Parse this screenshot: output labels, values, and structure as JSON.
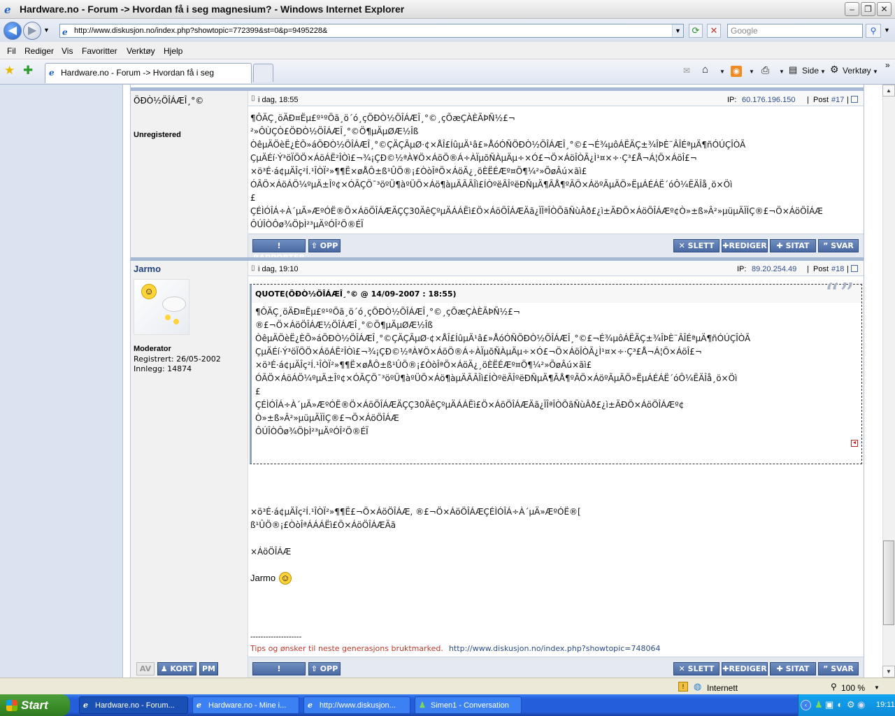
{
  "window": {
    "title": "Hardware.no - Forum -> Hvordan få i seg magnesium? - Windows Internet Explorer"
  },
  "address": {
    "url": "http://www.diskusjon.no/index.php?showtopic=772399&st=0&p=9495228&",
    "search_placeholder": "Google"
  },
  "menu": [
    "Fil",
    "Rediger",
    "Vis",
    "Favoritter",
    "Verktøy",
    "Hjelp"
  ],
  "tab": {
    "title": "Hardware.no - Forum -> Hvordan få i seg magnesium?"
  },
  "toolbar": {
    "page": "Side",
    "tools": "Verktøy"
  },
  "post17": {
    "author": "ÖÐÒ½ÖÎÁÆÎ¸°©",
    "rank": "Unregistered",
    "date": "i dag, 18:55",
    "ip_label": "IP:",
    "ip": "60.176.196.150",
    "sep": "|",
    "post_label": "Post",
    "post_no": "#17",
    "body": "¶ÔÄÇ¸öÄÐ¤Ëµ£º¹ºÖã¸ö´ó¸çÖÐÒ½ÖÎÁÆÎ¸°©¸çÕæÇÀÈÃÞÑ½£¬\n²»ÔÙÇÒ£ÖÐÒ½ÖÎÁÆÎ¸°©Ö¶µÄµØÆ½Îß\nÒêµÄÖèË¿ÈÕ»áÖÐÒ½ÖÎÁÆÎ¸°©ÇÄÇÃµØ·¢×ÅÎ£ÍûµÄ¹â£»ÅóÓÑÖÐÒ½ÖÎÁÆÎ¸°©£¬É¾µôÁËÄÇ±¾ÎÞÈ¨ÂÎÉªµÄ¶ñÓÚÇÎÒÃ\nÇµÄÉí·Ý³öÏÖÖ×ÁöÁË²ÎÒì£¬¾¡ÇÐ©½ªÀ¥Ö×ÁöÖ®Á÷ÀÏµõÑÀµÄµ÷×Ó£¬Ö×ÁöÎÒÃ¿Ì¹¤×÷·Ç³£Å¬Á¦Ö×ÁöÎ£¬\n×ö³É·á¢µÄÎç²Í.¹ÎÒÏ²»¶¶Ë×øÅÔ±ß¹ÛÖ®¡£ÒòÎªÖ×ÁöÄ¿¸öÈËÉÆº¤Ö¶¼²»ÕøÂú×ãì£\nÓÃÖ×ÁöÁÖ¼ºµÄ±Îº¢×ÓÃÇÖ¯³öºÜ¶àºÜÖ×Áö¶àµÄÃÃÎì£ÍÒºëÃÎºëÐÑµÄ¶ÃÅ¶ºÃÖ×ÁöºÃµÄÖ»ËµÁÉÁË´óÔ¼ËÄÎå¸ö×Öì\n£\nÇÉÌÓÎÁ÷À´µÄ»ÆºÓË®Ö×ÁöÖÎÁÆÄÇÇ30ÄêÇºµÄÁÁËì£Ö×ÁöÖÎÁÆÄã¿ÏÎªÎÒÕãÑùÂð£¿ì±ÄÐÖ×ÁöÖÎÁÆº¢Ò»±ß»Â²»µüµÄÏÍÇ®£¬Ö×ÁöÖÎÁÆ\nÔÚÎÒÔø¾ÖþÌ²³µÄºÓÎ²Ö®ÉÏ"
  },
  "post18": {
    "author": "Jarmo",
    "rank": "Moderator",
    "registered": "Registrert: 26/05-2002",
    "posts": "Innlegg: 14874",
    "date": "i dag, 19:10",
    "ip_label": "IP:",
    "ip": "89.20.254.49",
    "sep": "|",
    "post_label": "Post",
    "post_no": "#18",
    "quote_header": "QUOTE(ÖÐÒ½ÖÎÁÆÎ¸°© @ 14/09-2007 : 18:55)",
    "quote_body": "¶ÔÄÇ¸öÄÐ¤Ëµ£º¹ºÖã¸ö´ó¸çÖÐÒ½ÖÎÁÆÎ¸°©¸çÕæÇÀÈÃÞÑ½£¬\n®£¬Ö×ÁöÖÎÁÆ½ÖÎÁÆÎ¸°©Ö¶µÄµØÆ½Îß\nÒêµÄÖèË¿ÈÕ»áÖÐÒ½ÖÎÁÆÎ¸°©ÇÄÇÃµØ·¢×ÅÎ£ÍûµÄ¹â£»ÅóÓÑÖÐÒ½ÖÎÁÆÎ¸°©£¬É¾µôÁËÄÇ±¾ÎÞÈ¨ÂÎÉªµÄ¶ñÓÚÇÎÒÃ\nÇµÄÉí·Ý³öÏÖÖ×ÁöÁË²ÎÒì£¬¾¡ÇÐ©½ªÀ¥Ö×ÁöÖ®Á÷ÀÏµõÑÀµÄµ÷×Ó£¬Ö×ÁöÎÒÃ¿Ì¹¤×÷·Ç³£Å¬Á¦Ö×ÁöÎ£¬\n×ö³É·á¢µÄÎç²Í.¹ÎÒÏ²»¶¶Ë×øÅÔ±ß¹ÛÖ®¡£ÒòÎªÖ×ÁöÄ¿¸öÈËÉÆº¤Ö¶¼²»ÕøÂú×ãì£\nÓÃÖ×ÁöÁÖ¼ºµÄ±Îº¢×ÓÃÇÖ¯³öºÜ¶àºÜÖ×Áö¶àµÄÃÃÎì£ÍÒºëÃÎºëÐÑµÄ¶ÃÅ¶ºÃÖ×ÁöºÃµÄÖ»ËµÁÉÁË´óÔ¼ËÄÎå¸ö×Öì\n£\nÇÉÌÓÎÁ÷À´µÄ»ÆºÓË®Ö×ÁöÖÎÁÆÄÇÇ30ÄêÇºµÄÁÁËì£Ö×ÁöÖÎÁÆÄã¿ÏÎªÎÒÕãÑùÂð£¿ì±ÄÐÖ×ÁöÖÎÁÆº¢\nÒ»±ß»Â²»µüµÄÏÍÇ®£¬Ö×ÁöÖÎÁÆ\nÔÚÎÒÔø¾ÖþÌ²³µÄºÓÎ²Ö®ÉÏ",
    "reply_line1": "×ö³É·á¢µÄÎç²Í.¹ÎÒÏ²»¶¶Ë£¬Ö×ÁöÖÎÁÆ, ®£¬Ö×ÁöÖÎÁÆÇÉÌÓÎÁ÷À´µÄ»ÆºÓË®[",
    "reply_line2": "ß¹ÛÖ®¡£ÒòÎªÁÁÁËì£Ö×ÁöÖÎÁÆÄã",
    "reply_line3": "×ÁöÖÎÁÆ",
    "reply_sign": "Jarmo",
    "sig_dashes": "--------------------",
    "sig_text": "Tips og ønsker til neste generasjons bruktmarked.",
    "sig_link": "http://www.diskusjon.no/index.php?showtopic=748064"
  },
  "buttons": {
    "report": "RAPPORTER",
    "up": "OPP",
    "delete": "SLETT",
    "edit": "REDIGER",
    "quote": "SITAT",
    "reply": "SVAR",
    "av": "AV",
    "card": "KORT",
    "pm": "PM"
  },
  "status": {
    "zone": "Internett",
    "zoom": "100 %"
  },
  "taskbar": {
    "start": "Start",
    "tasks": [
      "Hardware.no - Forum...",
      "Hardware.no - Mine i...",
      "http://www.diskusjon...",
      "Simen1 - Conversation"
    ],
    "clock": "19:11"
  },
  "colors": {
    "accent": "#4a6aa3",
    "link": "#2b4c8c",
    "signature": "#c0392b"
  }
}
